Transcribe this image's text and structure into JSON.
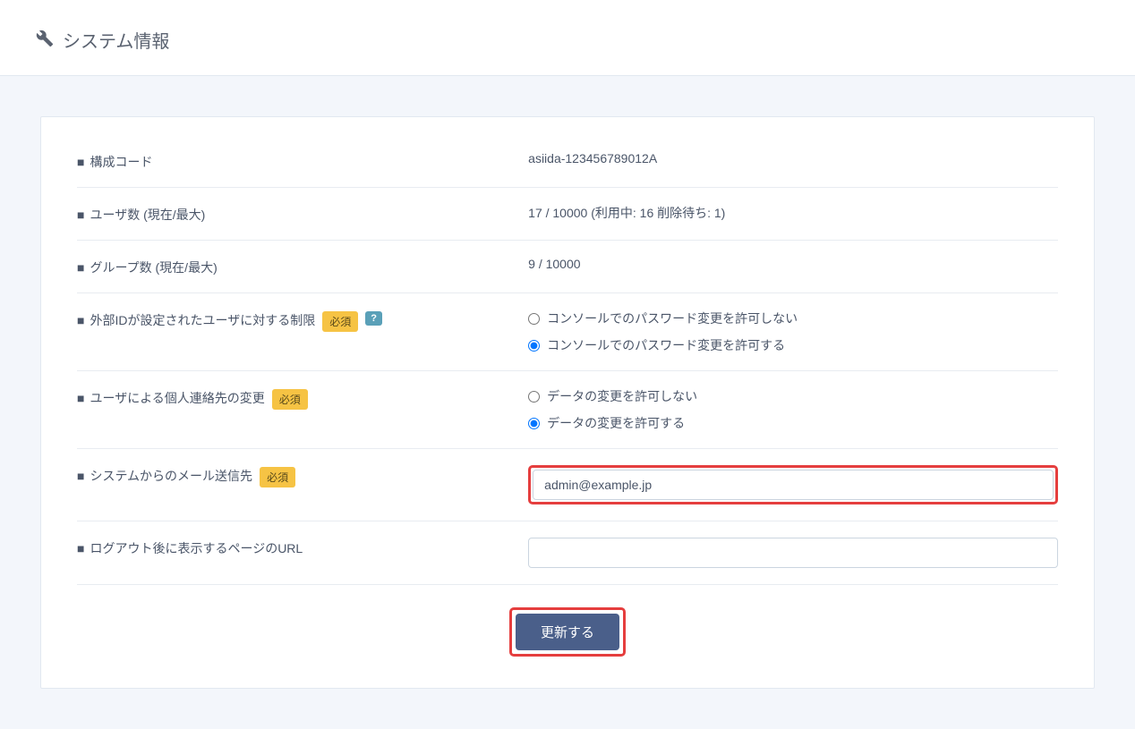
{
  "header": {
    "title": "システム情報"
  },
  "rows": {
    "config_code": {
      "label": "構成コード",
      "value": "asiida-123456789012A"
    },
    "user_count": {
      "label": "ユーザ数 (現在/最大)",
      "value": "17 / 10000 (利用中: 16 削除待ち: 1)"
    },
    "group_count": {
      "label": "グループ数 (現在/最大)",
      "value": "9 / 10000"
    },
    "external_id_restriction": {
      "label": "外部IDが設定されたユーザに対する制限",
      "required": "必須",
      "help": "?",
      "options": [
        "コンソールでのパスワード変更を許可しない",
        "コンソールでのパスワード変更を許可する"
      ]
    },
    "user_contact_change": {
      "label": "ユーザによる個人連絡先の変更",
      "required": "必須",
      "options": [
        "データの変更を許可しない",
        "データの変更を許可する"
      ]
    },
    "system_mail": {
      "label": "システムからのメール送信先",
      "required": "必須",
      "value": "admin@example.jp"
    },
    "logout_page": {
      "label": "ログアウト後に表示するページのURL",
      "value": ""
    }
  },
  "submit": {
    "label": "更新する"
  }
}
